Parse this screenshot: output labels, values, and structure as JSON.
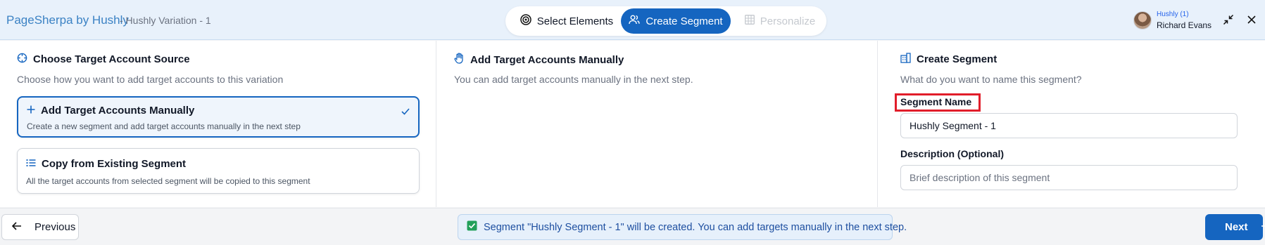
{
  "header": {
    "brand": "PageSherpa by Hushly",
    "variation": "- Hushly Variation - 1",
    "steps": [
      {
        "label": "Select Elements",
        "icon": "target-icon",
        "state": "completed"
      },
      {
        "label": "Create Segment",
        "icon": "users-icon",
        "state": "active"
      },
      {
        "label": "Personalize",
        "icon": "grid-icon",
        "state": "disabled"
      }
    ],
    "user": {
      "org": "Hushly (1)",
      "name": "Richard Evans"
    }
  },
  "source_panel": {
    "title": "Choose Target Account Source",
    "subtitle": "Choose how you want to add target accounts to this variation",
    "options": [
      {
        "title": "Add Target Accounts Manually",
        "description": "Create a new segment and add target accounts manually in the next step",
        "icon": "plus-icon",
        "selected": true
      },
      {
        "title": "Copy from Existing Segment",
        "description": "All the target accounts from selected segment will be copied to this segment",
        "icon": "list-icon",
        "selected": false
      }
    ]
  },
  "manual_panel": {
    "title": "Add Target Accounts Manually",
    "subtitle": "You can add target accounts manually in the next step."
  },
  "segment_panel": {
    "title": "Create Segment",
    "subtitle": "What do you want to name this segment?",
    "name_label": "Segment Name",
    "name_value": "Hushly Segment - 1",
    "description_label": "Description (Optional)",
    "description_placeholder": "Brief description of this segment"
  },
  "footer": {
    "previous_label": "Previous",
    "notice": "Segment \"Hushly Segment - 1\" will be created. You can add targets manually in the next step.",
    "next_label": "Next"
  },
  "colors": {
    "primary": "#1565c0",
    "brand": "#3b82c4",
    "highlight": "#e11d2a",
    "success": "#22a05a"
  }
}
